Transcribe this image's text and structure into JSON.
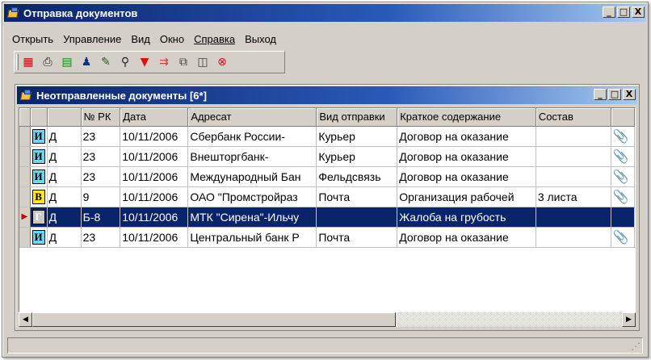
{
  "app": {
    "title": "Отправка документов",
    "window_buttons": [
      "_",
      "□",
      "X"
    ]
  },
  "menu": [
    {
      "label": "Открыть"
    },
    {
      "label": "Управление"
    },
    {
      "label": "Вид"
    },
    {
      "label": "Окно"
    },
    {
      "label": "Справка"
    },
    {
      "label": "Выход"
    }
  ],
  "toolbar": [
    {
      "icon": "grid-view-icon",
      "glyph": "▦",
      "color": "#b01010"
    },
    {
      "icon": "document-send-icon",
      "glyph": "⎙",
      "color": "#202020"
    },
    {
      "icon": "document-icon",
      "glyph": "▤",
      "color": "#208020"
    },
    {
      "icon": "users-icon",
      "glyph": "♟",
      "color": "#103080"
    },
    {
      "icon": "edit-icon",
      "glyph": "✎",
      "color": "#206020"
    },
    {
      "icon": "binoculars-icon",
      "glyph": "⚲",
      "color": "#202020"
    },
    {
      "icon": "filter-icon",
      "glyph": "▼",
      "color": "#e01010"
    },
    {
      "icon": "sort-icon",
      "glyph": "⇉",
      "color": "#d04040"
    },
    {
      "icon": "copy-icon",
      "glyph": "⧉",
      "color": "#404040"
    },
    {
      "icon": "preview-icon",
      "glyph": "◫",
      "color": "#404040"
    },
    {
      "icon": "delete-icon",
      "glyph": "⊗",
      "color": "#d01010"
    }
  ],
  "child_window": {
    "title": "Неотправленные документы [6*]",
    "columns": [
      "",
      "",
      "",
      "№ РК",
      "Дата",
      "Адресат",
      "Вид отправки",
      "Краткое содержание",
      "Состав",
      ""
    ],
    "rows": [
      {
        "badge": "И",
        "badge_color": "cyan",
        "kind": "Д",
        "num": "23",
        "date": "10/11/2006",
        "addressee": "Сбербанк России-",
        "method": "Курьер",
        "summary": "Договор на оказание",
        "contents": "",
        "clip": true,
        "selected": false
      },
      {
        "badge": "И",
        "badge_color": "cyan",
        "kind": "Д",
        "num": "23",
        "date": "10/11/2006",
        "addressee": "Внешторгбанк-",
        "method": "Курьер",
        "summary": "Договор на оказание",
        "contents": "",
        "clip": true,
        "selected": false
      },
      {
        "badge": "И",
        "badge_color": "cyan",
        "kind": "Д",
        "num": "23",
        "date": "10/11/2006",
        "addressee": "Международный Бан",
        "method": "Фельдсвязь",
        "summary": "Договор на оказание",
        "contents": "",
        "clip": true,
        "selected": false
      },
      {
        "badge": "В",
        "badge_color": "yellow",
        "kind": "Д",
        "num": "9",
        "date": "10/11/2006",
        "addressee": "ОАО \"Промстройраз",
        "method": "Почта",
        "summary": "Организация рабочей",
        "contents": "3 листа",
        "clip": true,
        "selected": false
      },
      {
        "badge": "Г",
        "badge_color": "gray",
        "kind": "Д",
        "num": "Б-8",
        "date": "10/11/2006",
        "addressee": "МТК \"Сирена\"-Ильчу",
        "method": "",
        "summary": "Жалоба на грубость",
        "contents": "",
        "clip": false,
        "selected": true
      },
      {
        "badge": "И",
        "badge_color": "cyan",
        "kind": "Д",
        "num": "23",
        "date": "10/11/2006",
        "addressee": "Центральный банк Р",
        "method": "Почта",
        "summary": "Договор на оказание",
        "contents": "",
        "clip": true,
        "selected": false
      }
    ]
  },
  "scroll": {
    "left_arrow": "◀",
    "right_arrow": "▶"
  },
  "status": {
    "grip": "⋰"
  }
}
